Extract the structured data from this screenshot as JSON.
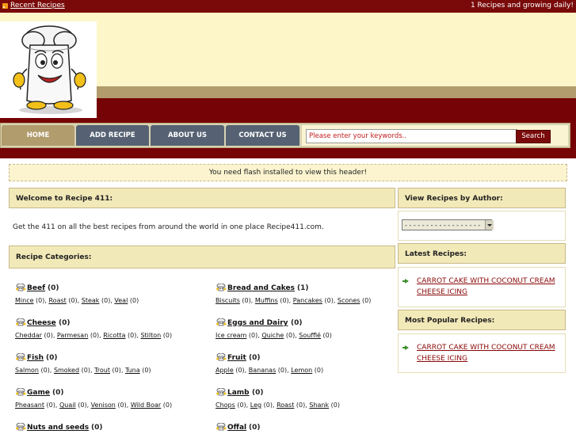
{
  "topbar": {
    "recent_label": "Recent Recipes",
    "growing_text": "1 Recipes and growing daily!"
  },
  "nav": {
    "home": "HOME",
    "add": "ADD RECIPE",
    "about": "ABOUT US",
    "contact": "CONTACT US"
  },
  "search": {
    "value": "Please enter your keywords..",
    "button": "Search"
  },
  "flash_notice": "You need flash installed to view this header!",
  "welcome": {
    "title": "Welcome to Recipe 411:",
    "text": "Get the 411 on all the best recipes from around the world in one place Recipe411.com."
  },
  "categories_title": "Recipe Categories:",
  "categories": [
    {
      "name": "Beef",
      "count": "(0)",
      "subs": [
        [
          "Mince",
          "(0)"
        ],
        [
          "Roast",
          "(0)"
        ],
        [
          "Steak",
          "(0)"
        ],
        [
          "Veal",
          "(0)"
        ]
      ]
    },
    {
      "name": "Bread and Cakes",
      "count": "(1)",
      "subs": [
        [
          "Biscuits",
          "(0)"
        ],
        [
          "Muffins",
          "(0)"
        ],
        [
          "Pancakes",
          "(0)"
        ],
        [
          "Scones",
          "(0)"
        ]
      ]
    },
    {
      "name": "Cheese",
      "count": "(0)",
      "subs": [
        [
          "Cheddar",
          "(0)"
        ],
        [
          "Parmesan",
          "(0)"
        ],
        [
          "Ricotta",
          "(0)"
        ],
        [
          "Stilton",
          "(0)"
        ]
      ]
    },
    {
      "name": "Eggs and Dairy",
      "count": "(0)",
      "subs": [
        [
          "Ice cream",
          "(0)"
        ],
        [
          "Quiche",
          "(0)"
        ],
        [
          "Soufflé",
          "(0)"
        ]
      ]
    },
    {
      "name": "Fish",
      "count": "(0)",
      "subs": [
        [
          "Salmon",
          "(0)"
        ],
        [
          "Smoked",
          "(0)"
        ],
        [
          "Trout",
          "(0)"
        ],
        [
          "Tuna",
          "(0)"
        ]
      ]
    },
    {
      "name": "Fruit",
      "count": "(0)",
      "subs": [
        [
          "Apple",
          "(0)"
        ],
        [
          "Bananas",
          "(0)"
        ],
        [
          "Lemon",
          "(0)"
        ]
      ]
    },
    {
      "name": "Game",
      "count": "(0)",
      "subs": [
        [
          "Pheasant",
          "(0)"
        ],
        [
          "Quail",
          "(0)"
        ],
        [
          "Venison",
          "(0)"
        ],
        [
          "Wild Boar",
          "(0)"
        ]
      ]
    },
    {
      "name": "Lamb",
      "count": "(0)",
      "subs": [
        [
          "Chops",
          "(0)"
        ],
        [
          "Leg",
          "(0)"
        ],
        [
          "Roast",
          "(0)"
        ],
        [
          "Shank",
          "(0)"
        ]
      ]
    },
    {
      "name": "Nuts and seeds",
      "count": "(0)",
      "subs": []
    },
    {
      "name": "Offal",
      "count": "(0)",
      "subs": []
    }
  ],
  "sidebar": {
    "author_title": "View Recipes by Author:",
    "author_select": "- - - - - - - - - - - - - - - - - -",
    "latest_title": "Latest Recipes:",
    "latest_recipe": "CARROT CAKE WITH COCONUT CREAM CHEESE ICING",
    "popular_title": "Most Popular Recipes:",
    "popular_recipe": "CARROT CAKE WITH COCONUT CREAM CHEESE ICING"
  },
  "colors": {
    "maroon": "#760406",
    "cream": "#fdf6c8",
    "tan": "#b29b6c",
    "nav_slate": "#566273",
    "link_red": "#8a0707"
  }
}
